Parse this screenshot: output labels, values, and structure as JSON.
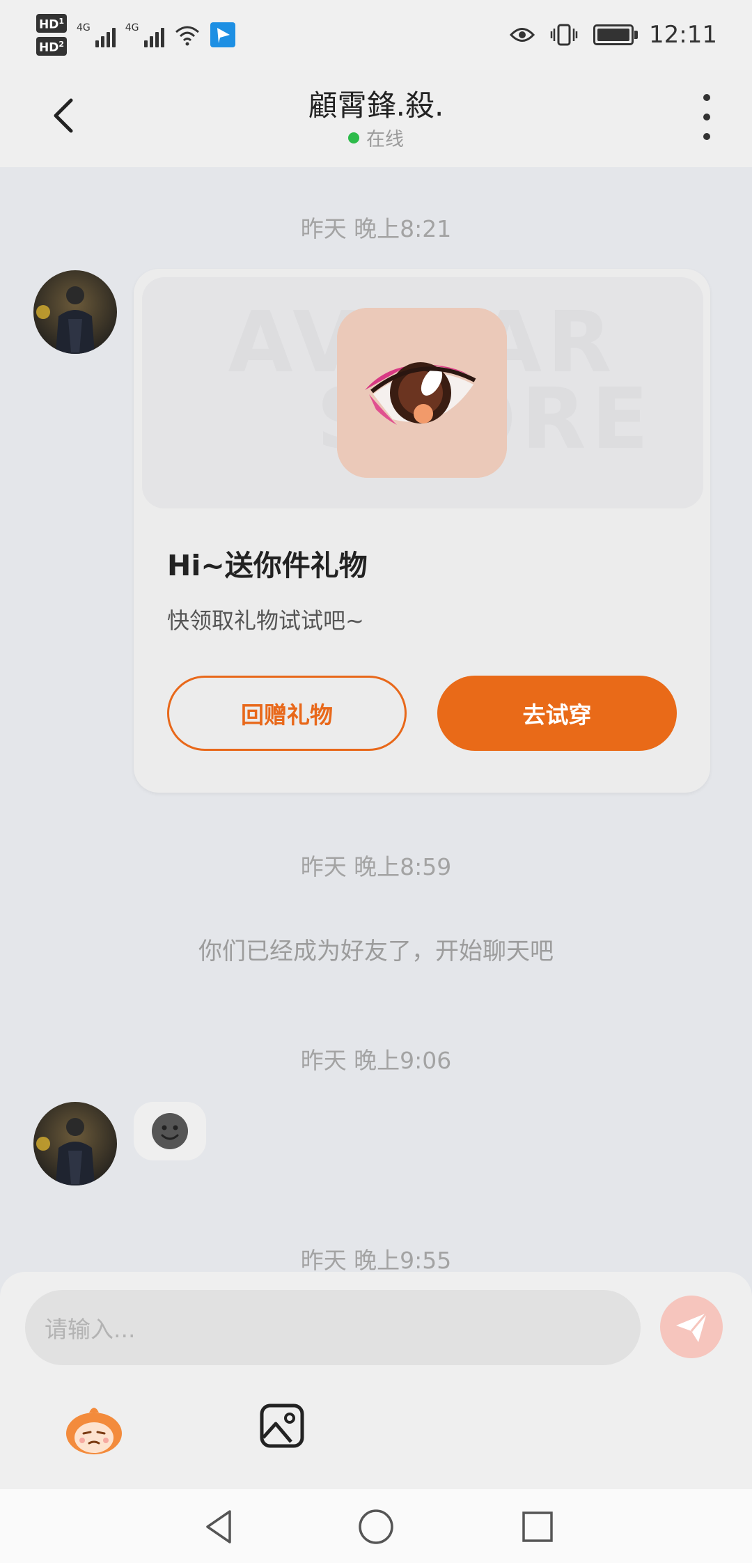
{
  "status_bar": {
    "sim1": "HD",
    "sim1_index": "1",
    "sim2": "HD",
    "sim2_index": "2",
    "net1": "4G",
    "net2": "4G",
    "time": "12:11"
  },
  "header": {
    "title": "顧霄鋒.殺.",
    "status": "在线"
  },
  "chat": {
    "timestamps": [
      "昨天 晚上8:21",
      "昨天 晚上8:59",
      "昨天 晚上9:06",
      "昨天 晚上9:55"
    ],
    "gift_card": {
      "banner_watermark_1": "AVATAR",
      "banner_watermark_2": "STORE",
      "title": "Hi~送你件礼物",
      "subtitle": "快领取礼物试试吧~",
      "return_button": "回赠礼物",
      "try_button": "去试穿"
    },
    "system_message": "你们已经成为好友了，开始聊天吧"
  },
  "input": {
    "placeholder": "请输入..."
  },
  "colors": {
    "accent": "#e96a18",
    "online": "#2dbb4a",
    "send_button": "#f6c5bd",
    "background": "#e4e6ea"
  },
  "icons": [
    "back-icon",
    "more-icon",
    "send-icon",
    "mascot-icon",
    "image-icon",
    "nav-back-icon",
    "nav-home-icon",
    "nav-recent-icon"
  ]
}
